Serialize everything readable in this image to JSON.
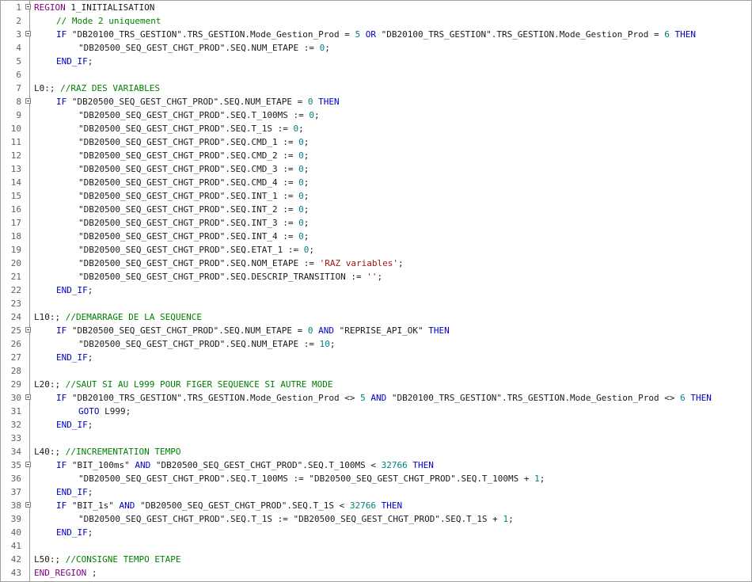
{
  "editor": {
    "colors": {
      "keyword": "#0000c8",
      "region": "#800080",
      "comment": "#008000",
      "number": "#008080",
      "string": "#a31515",
      "text": "#1a1a1a",
      "line_number": "#606060"
    },
    "lines": [
      {
        "n": "1",
        "fold": true,
        "indent": 0,
        "tokens": [
          [
            "region",
            "REGION"
          ],
          [
            "plain",
            " 1_INITIALISATION"
          ]
        ]
      },
      {
        "n": "2",
        "fold": false,
        "indent": 4,
        "tokens": [
          [
            "comment",
            "// Mode 2 uniquement"
          ]
        ]
      },
      {
        "n": "3",
        "fold": true,
        "indent": 4,
        "tokens": [
          [
            "kw",
            "IF"
          ],
          [
            "plain",
            " \"DB20100_TRS_GESTION\".TRS_GESTION.Mode_Gestion_Prod = "
          ],
          [
            "num",
            "5"
          ],
          [
            "plain",
            " "
          ],
          [
            "kw",
            "OR"
          ],
          [
            "plain",
            " \"DB20100_TRS_GESTION\".TRS_GESTION.Mode_Gestion_Prod = "
          ],
          [
            "num",
            "6"
          ],
          [
            "plain",
            " "
          ],
          [
            "kw",
            "THEN"
          ]
        ]
      },
      {
        "n": "4",
        "fold": false,
        "indent": 8,
        "tokens": [
          [
            "plain",
            "\"DB20500_SEQ_GEST_CHGT_PROD\".SEQ.NUM_ETAPE := "
          ],
          [
            "num",
            "0"
          ],
          [
            "plain",
            ";"
          ]
        ]
      },
      {
        "n": "5",
        "fold": false,
        "indent": 4,
        "tokens": [
          [
            "kw",
            "END_IF"
          ],
          [
            "plain",
            ";"
          ]
        ]
      },
      {
        "n": "6",
        "fold": false,
        "indent": 0,
        "tokens": []
      },
      {
        "n": "7",
        "fold": false,
        "indent": 0,
        "tokens": [
          [
            "plain",
            "L0:; "
          ],
          [
            "comment",
            "//RAZ DES VARIABLES"
          ]
        ]
      },
      {
        "n": "8",
        "fold": true,
        "indent": 4,
        "tokens": [
          [
            "kw",
            "IF"
          ],
          [
            "plain",
            " \"DB20500_SEQ_GEST_CHGT_PROD\".SEQ.NUM_ETAPE = "
          ],
          [
            "num",
            "0"
          ],
          [
            "plain",
            " "
          ],
          [
            "kw",
            "THEN"
          ]
        ]
      },
      {
        "n": "9",
        "fold": false,
        "indent": 8,
        "tokens": [
          [
            "plain",
            "\"DB20500_SEQ_GEST_CHGT_PROD\".SEQ.T_100MS := "
          ],
          [
            "num",
            "0"
          ],
          [
            "plain",
            ";"
          ]
        ]
      },
      {
        "n": "10",
        "fold": false,
        "indent": 8,
        "tokens": [
          [
            "plain",
            "\"DB20500_SEQ_GEST_CHGT_PROD\".SEQ.T_1S := "
          ],
          [
            "num",
            "0"
          ],
          [
            "plain",
            ";"
          ]
        ]
      },
      {
        "n": "11",
        "fold": false,
        "indent": 8,
        "tokens": [
          [
            "plain",
            "\"DB20500_SEQ_GEST_CHGT_PROD\".SEQ.CMD_1 := "
          ],
          [
            "num",
            "0"
          ],
          [
            "plain",
            ";"
          ]
        ]
      },
      {
        "n": "12",
        "fold": false,
        "indent": 8,
        "tokens": [
          [
            "plain",
            "\"DB20500_SEQ_GEST_CHGT_PROD\".SEQ.CMD_2 := "
          ],
          [
            "num",
            "0"
          ],
          [
            "plain",
            ";"
          ]
        ]
      },
      {
        "n": "13",
        "fold": false,
        "indent": 8,
        "tokens": [
          [
            "plain",
            "\"DB20500_SEQ_GEST_CHGT_PROD\".SEQ.CMD_3 := "
          ],
          [
            "num",
            "0"
          ],
          [
            "plain",
            ";"
          ]
        ]
      },
      {
        "n": "14",
        "fold": false,
        "indent": 8,
        "tokens": [
          [
            "plain",
            "\"DB20500_SEQ_GEST_CHGT_PROD\".SEQ.CMD_4 := "
          ],
          [
            "num",
            "0"
          ],
          [
            "plain",
            ";"
          ]
        ]
      },
      {
        "n": "15",
        "fold": false,
        "indent": 8,
        "tokens": [
          [
            "plain",
            "\"DB20500_SEQ_GEST_CHGT_PROD\".SEQ.INT_1 := "
          ],
          [
            "num",
            "0"
          ],
          [
            "plain",
            ";"
          ]
        ]
      },
      {
        "n": "16",
        "fold": false,
        "indent": 8,
        "tokens": [
          [
            "plain",
            "\"DB20500_SEQ_GEST_CHGT_PROD\".SEQ.INT_2 := "
          ],
          [
            "num",
            "0"
          ],
          [
            "plain",
            ";"
          ]
        ]
      },
      {
        "n": "17",
        "fold": false,
        "indent": 8,
        "tokens": [
          [
            "plain",
            "\"DB20500_SEQ_GEST_CHGT_PROD\".SEQ.INT_3 := "
          ],
          [
            "num",
            "0"
          ],
          [
            "plain",
            ";"
          ]
        ]
      },
      {
        "n": "18",
        "fold": false,
        "indent": 8,
        "tokens": [
          [
            "plain",
            "\"DB20500_SEQ_GEST_CHGT_PROD\".SEQ.INT_4 := "
          ],
          [
            "num",
            "0"
          ],
          [
            "plain",
            ";"
          ]
        ]
      },
      {
        "n": "19",
        "fold": false,
        "indent": 8,
        "tokens": [
          [
            "plain",
            "\"DB20500_SEQ_GEST_CHGT_PROD\".SEQ.ETAT_1 := "
          ],
          [
            "num",
            "0"
          ],
          [
            "plain",
            ";"
          ]
        ]
      },
      {
        "n": "20",
        "fold": false,
        "indent": 8,
        "tokens": [
          [
            "plain",
            "\"DB20500_SEQ_GEST_CHGT_PROD\".SEQ.NOM_ETAPE := "
          ],
          [
            "str",
            "'RAZ variables'"
          ],
          [
            "plain",
            ";"
          ]
        ]
      },
      {
        "n": "21",
        "fold": false,
        "indent": 8,
        "tokens": [
          [
            "plain",
            "\"DB20500_SEQ_GEST_CHGT_PROD\".SEQ.DESCRIP_TRANSITION := "
          ],
          [
            "str",
            "''"
          ],
          [
            "plain",
            ";"
          ]
        ]
      },
      {
        "n": "22",
        "fold": false,
        "indent": 4,
        "tokens": [
          [
            "kw",
            "END_IF"
          ],
          [
            "plain",
            ";"
          ]
        ]
      },
      {
        "n": "23",
        "fold": false,
        "indent": 0,
        "tokens": []
      },
      {
        "n": "24",
        "fold": false,
        "indent": 0,
        "tokens": [
          [
            "plain",
            "L10:; "
          ],
          [
            "comment",
            "//DEMARRAGE DE LA SEQUENCE"
          ]
        ]
      },
      {
        "n": "25",
        "fold": true,
        "indent": 4,
        "tokens": [
          [
            "kw",
            "IF"
          ],
          [
            "plain",
            " \"DB20500_SEQ_GEST_CHGT_PROD\".SEQ.NUM_ETAPE = "
          ],
          [
            "num",
            "0"
          ],
          [
            "plain",
            " "
          ],
          [
            "kw",
            "AND"
          ],
          [
            "plain",
            " \"REPRISE_API_OK\" "
          ],
          [
            "kw",
            "THEN"
          ]
        ]
      },
      {
        "n": "26",
        "fold": false,
        "indent": 8,
        "tokens": [
          [
            "plain",
            "\"DB20500_SEQ_GEST_CHGT_PROD\".SEQ.NUM_ETAPE := "
          ],
          [
            "num",
            "10"
          ],
          [
            "plain",
            ";"
          ]
        ]
      },
      {
        "n": "27",
        "fold": false,
        "indent": 4,
        "tokens": [
          [
            "kw",
            "END_IF"
          ],
          [
            "plain",
            ";"
          ]
        ]
      },
      {
        "n": "28",
        "fold": false,
        "indent": 0,
        "tokens": []
      },
      {
        "n": "29",
        "fold": false,
        "indent": 0,
        "tokens": [
          [
            "plain",
            "L20:; "
          ],
          [
            "comment",
            "//SAUT SI AU L999 POUR FIGER SEQUENCE SI AUTRE MODE"
          ]
        ]
      },
      {
        "n": "30",
        "fold": true,
        "indent": 4,
        "tokens": [
          [
            "kw",
            "IF"
          ],
          [
            "plain",
            " \"DB20100_TRS_GESTION\".TRS_GESTION.Mode_Gestion_Prod <> "
          ],
          [
            "num",
            "5"
          ],
          [
            "plain",
            " "
          ],
          [
            "kw",
            "AND"
          ],
          [
            "plain",
            " \"DB20100_TRS_GESTION\".TRS_GESTION.Mode_Gestion_Prod <> "
          ],
          [
            "num",
            "6"
          ],
          [
            "plain",
            " "
          ],
          [
            "kw",
            "THEN"
          ]
        ]
      },
      {
        "n": "31",
        "fold": false,
        "indent": 8,
        "tokens": [
          [
            "kw",
            "GOTO"
          ],
          [
            "plain",
            " L999;"
          ]
        ]
      },
      {
        "n": "32",
        "fold": false,
        "indent": 4,
        "tokens": [
          [
            "kw",
            "END_IF"
          ],
          [
            "plain",
            ";"
          ]
        ]
      },
      {
        "n": "33",
        "fold": false,
        "indent": 0,
        "tokens": []
      },
      {
        "n": "34",
        "fold": false,
        "indent": 0,
        "tokens": [
          [
            "plain",
            "L40:; "
          ],
          [
            "comment",
            "//INCREMENTATION TEMPO"
          ]
        ]
      },
      {
        "n": "35",
        "fold": true,
        "indent": 4,
        "tokens": [
          [
            "kw",
            "IF"
          ],
          [
            "plain",
            " \"BIT_100ms\" "
          ],
          [
            "kw",
            "AND"
          ],
          [
            "plain",
            " \"DB20500_SEQ_GEST_CHGT_PROD\".SEQ.T_100MS < "
          ],
          [
            "num",
            "32766"
          ],
          [
            "plain",
            " "
          ],
          [
            "kw",
            "THEN"
          ]
        ]
      },
      {
        "n": "36",
        "fold": false,
        "indent": 8,
        "tokens": [
          [
            "plain",
            "\"DB20500_SEQ_GEST_CHGT_PROD\".SEQ.T_100MS := \"DB20500_SEQ_GEST_CHGT_PROD\".SEQ.T_100MS + "
          ],
          [
            "num",
            "1"
          ],
          [
            "plain",
            ";"
          ]
        ]
      },
      {
        "n": "37",
        "fold": false,
        "indent": 4,
        "tokens": [
          [
            "kw",
            "END_IF"
          ],
          [
            "plain",
            ";"
          ]
        ]
      },
      {
        "n": "38",
        "fold": true,
        "indent": 4,
        "tokens": [
          [
            "kw",
            "IF"
          ],
          [
            "plain",
            " \"BIT_1s\" "
          ],
          [
            "kw",
            "AND"
          ],
          [
            "plain",
            " \"DB20500_SEQ_GEST_CHGT_PROD\".SEQ.T_1S < "
          ],
          [
            "num",
            "32766"
          ],
          [
            "plain",
            " "
          ],
          [
            "kw",
            "THEN"
          ]
        ]
      },
      {
        "n": "39",
        "fold": false,
        "indent": 8,
        "tokens": [
          [
            "plain",
            "\"DB20500_SEQ_GEST_CHGT_PROD\".SEQ.T_1S := \"DB20500_SEQ_GEST_CHGT_PROD\".SEQ.T_1S + "
          ],
          [
            "num",
            "1"
          ],
          [
            "plain",
            ";"
          ]
        ]
      },
      {
        "n": "40",
        "fold": false,
        "indent": 4,
        "tokens": [
          [
            "kw",
            "END_IF"
          ],
          [
            "plain",
            ";"
          ]
        ]
      },
      {
        "n": "41",
        "fold": false,
        "indent": 0,
        "tokens": []
      },
      {
        "n": "42",
        "fold": false,
        "indent": 0,
        "tokens": [
          [
            "plain",
            "L50:; "
          ],
          [
            "comment",
            "//CONSIGNE TEMPO ETAPE"
          ]
        ]
      },
      {
        "n": "43",
        "fold": false,
        "indent": 0,
        "tokens": [
          [
            "region",
            "END_REGION"
          ],
          [
            "plain",
            " ;"
          ]
        ]
      }
    ]
  }
}
